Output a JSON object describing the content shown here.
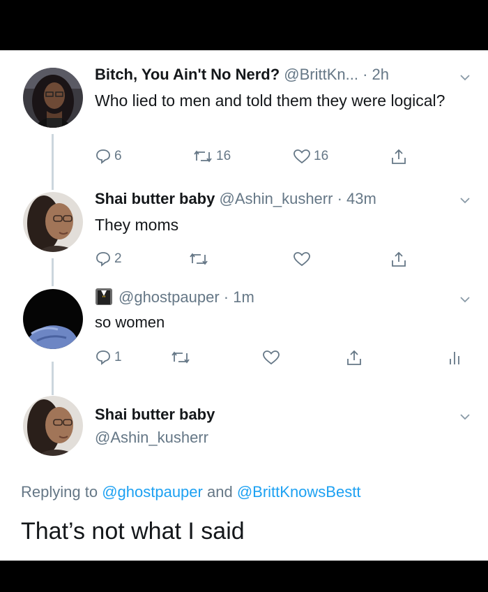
{
  "tweets": [
    {
      "name": "Bitch, You Ain't No Nerd?",
      "handle": "@BrittKn...",
      "time": "· 2h",
      "text": "Who lied to men and told them they were logical?",
      "replies": "6",
      "retweets": "16",
      "likes": "16"
    },
    {
      "name": "Shai butter baby",
      "handle": "@Ashin_kusherr",
      "time": "· 43m",
      "text": "They moms",
      "replies": "2",
      "retweets": "",
      "likes": ""
    },
    {
      "name": "",
      "handle": "@ghostpauper",
      "time": "· 1m",
      "text": "so women",
      "replies": "1",
      "retweets": "",
      "likes": ""
    }
  ],
  "focused": {
    "name": "Shai butter baby",
    "handle": "@Ashin_kusherr",
    "replying_prefix": "Replying to",
    "mention1": "@ghostpauper",
    "conj": "and",
    "mention2": "@BrittKnowsBestt",
    "text": "That’s not what I said"
  },
  "colors": {
    "text": "#14171a",
    "secondary": "#657786",
    "link": "#1da1f2",
    "thread_line": "#ccd6dd"
  },
  "icons": [
    "reply-icon",
    "retweet-icon",
    "like-icon",
    "share-icon",
    "analytics-icon",
    "chevron-down-icon"
  ]
}
